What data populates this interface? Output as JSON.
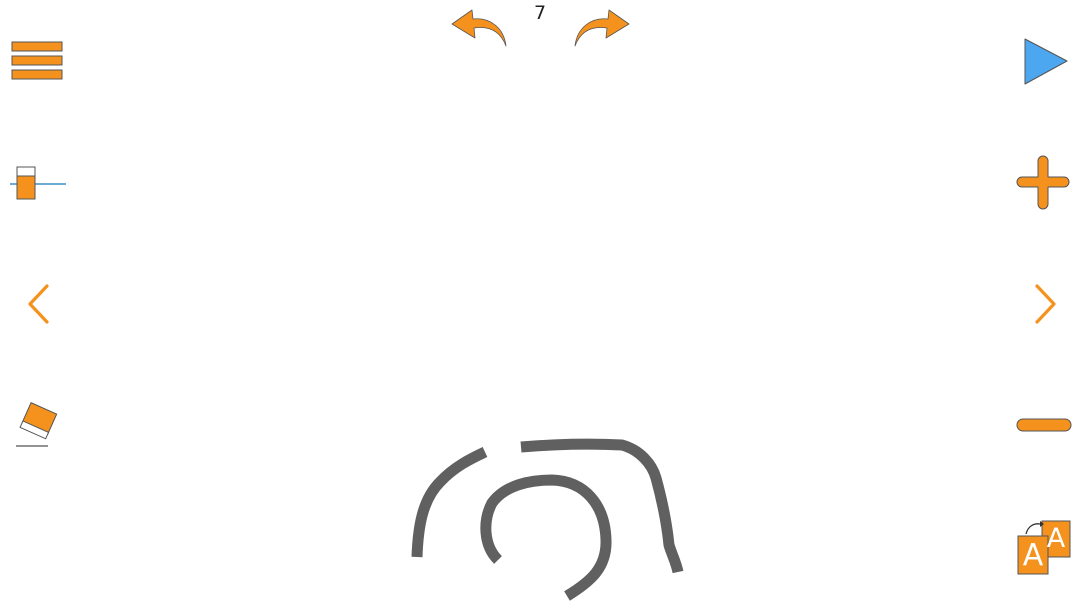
{
  "page": {
    "number": "7"
  },
  "theme": {
    "accent": "#F5921E",
    "accent_stroke": "#555555",
    "play": "#4DA6F0",
    "ink": "#606060",
    "slider_line": "#3D8FC9"
  },
  "left_toolbar": {
    "items": [
      {
        "name": "menu",
        "icon": "hamburger-menu-icon"
      },
      {
        "name": "pen-thickness",
        "icon": "thickness-slider-icon"
      },
      {
        "name": "previous-page",
        "icon": "chevron-left-icon"
      },
      {
        "name": "eraser",
        "icon": "eraser-icon"
      }
    ]
  },
  "right_toolbar": {
    "items": [
      {
        "name": "play",
        "icon": "play-icon"
      },
      {
        "name": "zoom-in",
        "icon": "plus-icon"
      },
      {
        "name": "next-page",
        "icon": "chevron-right-icon"
      },
      {
        "name": "zoom-out",
        "icon": "minus-icon"
      },
      {
        "name": "change-letter",
        "icon": "letter-swap-icon"
      }
    ]
  },
  "top_toolbar": {
    "items": [
      {
        "name": "undo",
        "icon": "undo-arrow-icon"
      },
      {
        "name": "redo",
        "icon": "redo-arrow-icon"
      }
    ]
  },
  "letter_swap": {
    "front_letter": "A",
    "back_letter": "A"
  }
}
